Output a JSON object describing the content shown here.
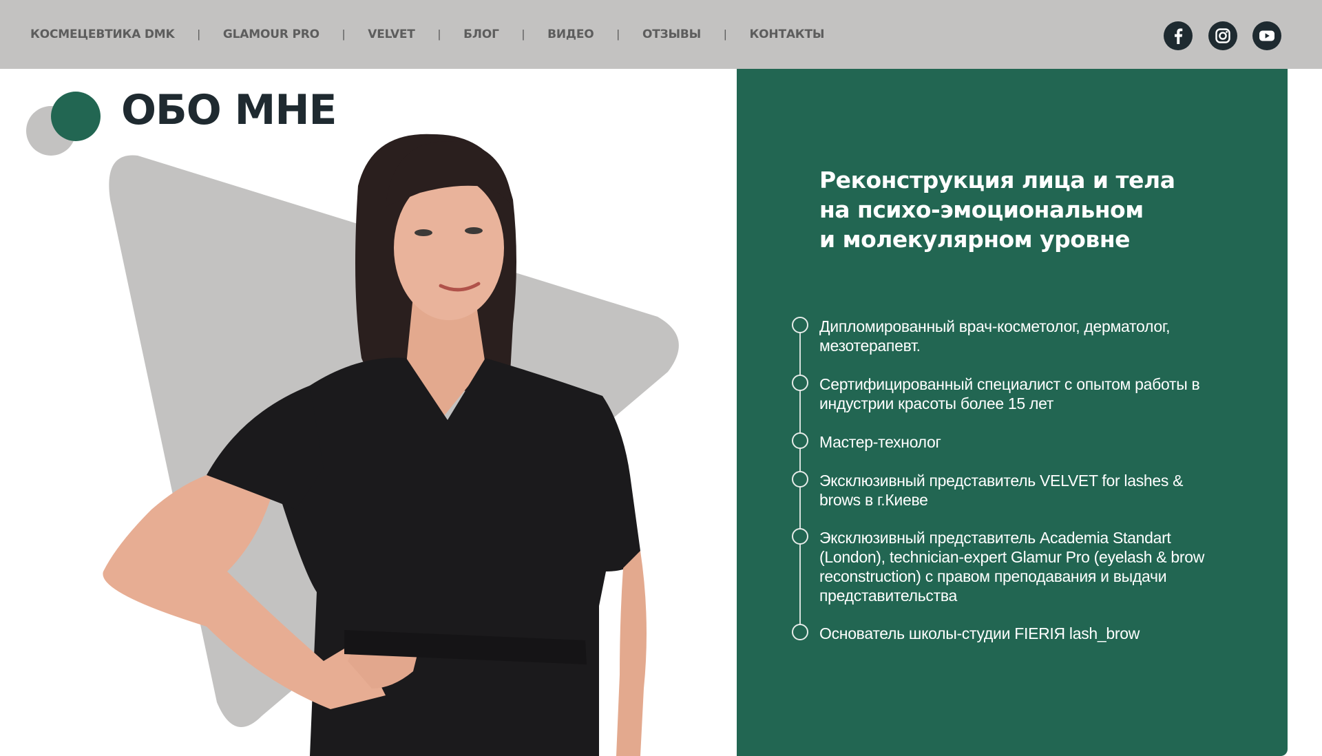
{
  "nav": {
    "items": [
      {
        "label": "КОСМЕЦЕВТИКА DMK"
      },
      {
        "label": "GLAMOUR PRO"
      },
      {
        "label": "VELVET"
      },
      {
        "label": "БЛОГ"
      },
      {
        "label": "ВИДЕО"
      },
      {
        "label": "ОТЗЫВЫ"
      },
      {
        "label": "КОНТАКТЫ"
      }
    ],
    "separator": "|"
  },
  "social": [
    {
      "icon": "facebook-icon"
    },
    {
      "icon": "instagram-icon"
    },
    {
      "icon": "youtube-icon"
    }
  ],
  "about": {
    "title": "ОБО МНЕ"
  },
  "panel": {
    "heading": "Реконструкция лица и тела на психо-эмоциональном и молекулярном уровне",
    "heading_lines": [
      "Реконструкция лица и тела",
      "на психо-эмоциональном",
      "и молекулярном уровне"
    ],
    "items": [
      {
        "text": "Дипломированный врач-косметолог, дерматолог, мезотерапевт."
      },
      {
        "text": "Сертифицированный специалист с опытом работы в индустрии красоты более 15 лет"
      },
      {
        "text": "Мастер-технолог"
      },
      {
        "text": "Эксклюзивный представитель VELVET for lashes & brows в г.Киеве"
      },
      {
        "text": "Эксклюзивный представитель Academia Standart (London), technician-expert Glamur Pro (eyelash & brow reconstruction) с правом преподавания и выдачи представительства"
      },
      {
        "text": "Основатель школы-студии FIERIЯ lash_brow"
      }
    ]
  },
  "colors": {
    "topbar": "#c3c2c1",
    "nav_text": "#5d5d5d",
    "brand_green": "#226652",
    "title_dark": "#1f2a30",
    "shape_gray": "#c3c2c1"
  }
}
